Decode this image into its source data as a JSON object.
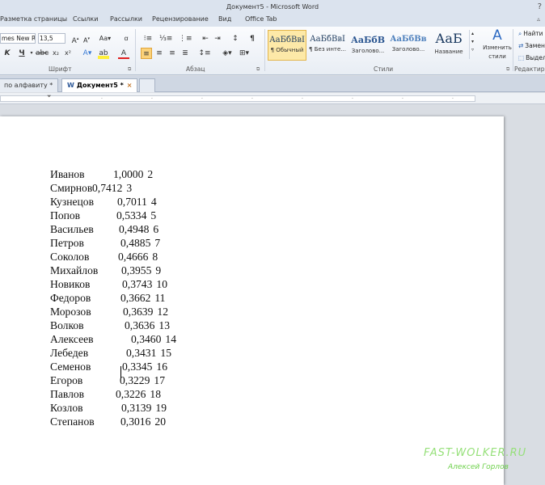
{
  "window": {
    "title": "Документ5 - Microsoft Word"
  },
  "menu": [
    {
      "label": "Разметка страницы"
    },
    {
      "label": "Ссылки"
    },
    {
      "label": "Рассылки"
    },
    {
      "label": "Рецензирование"
    },
    {
      "label": "Вид"
    },
    {
      "label": "Office Tab"
    }
  ],
  "ribbon": {
    "font": {
      "name": "mes New Rc",
      "size": "13,5",
      "group_label": "Шрифт"
    },
    "paragraph": {
      "group_label": "Абзац"
    },
    "styles": {
      "group_label": "Стили",
      "tiles": [
        {
          "sample": "АаБбВвІ",
          "name": "¶ Обычный",
          "selected": true
        },
        {
          "sample": "АаБбВвІ",
          "name": "¶ Без инте..."
        },
        {
          "sample": "АаБбВ",
          "name": "Заголово..."
        },
        {
          "sample": "АаБбВв",
          "name": "Заголово..."
        },
        {
          "sample": "АаБ",
          "name": "Название"
        }
      ],
      "change_label": "Изменить стили"
    },
    "editing": {
      "group_label": "Редактиро",
      "find": "Найти",
      "replace": "Замен",
      "select": "Выдел"
    }
  },
  "doc_tabs": [
    {
      "label": "по алфавиту *",
      "active": false
    },
    {
      "label": "Документ5 *",
      "active": true
    }
  ],
  "document": {
    "rows": [
      {
        "name": "Иванов",
        "value": "1,0000",
        "rank": "2"
      },
      {
        "name": "Смирнов",
        "value": "0,7412",
        "rank": "3"
      },
      {
        "name": "Кузнецов",
        "value": "0,7011",
        "rank": "4"
      },
      {
        "name": "Попов",
        "value": "0,5334",
        "rank": "5"
      },
      {
        "name": "Васильев",
        "value": "0,4948",
        "rank": "6"
      },
      {
        "name": "Петров",
        "value": "0,4885",
        "rank": "7"
      },
      {
        "name": "Соколов",
        "value": "0,4666",
        "rank": "8"
      },
      {
        "name": "Михайлов",
        "value": "0,3955",
        "rank": "9"
      },
      {
        "name": "Новиков",
        "value": "0,3743",
        "rank": "10"
      },
      {
        "name": "Федоров",
        "value": "0,3662",
        "rank": "11"
      },
      {
        "name": "Морозов",
        "value": "0,3639",
        "rank": "12"
      },
      {
        "name": "Волков",
        "value": "0,3636",
        "rank": "13"
      },
      {
        "name": "Алексеев",
        "value": "0,3460",
        "rank": "14"
      },
      {
        "name": "Лебедев",
        "value": "0,3431",
        "rank": "15"
      },
      {
        "name": "Семенов",
        "value": "0,3345",
        "rank": "16"
      },
      {
        "name": "Егоров",
        "value": "0,3229",
        "rank": "17"
      },
      {
        "name": "Павлов",
        "value": "0,3226",
        "rank": "18"
      },
      {
        "name": "Козлов",
        "value": "0,3139",
        "rank": "19"
      },
      {
        "name": "Степанов",
        "value": "0,3016",
        "rank": "20"
      }
    ]
  },
  "watermark": {
    "site": "FAST-WOLKER.RU",
    "author": "Алексей Горлов"
  }
}
